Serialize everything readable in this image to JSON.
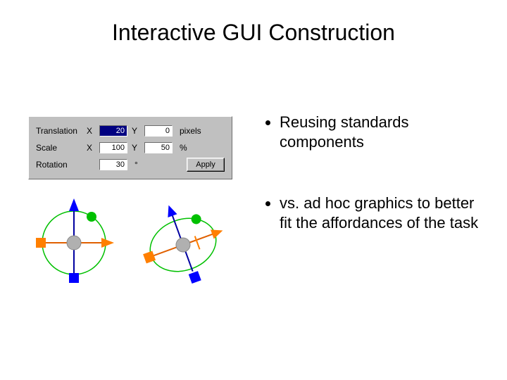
{
  "title": "Interactive GUI Construction",
  "panel": {
    "translation": {
      "label": "Translation",
      "xLabel": "X",
      "x": "20",
      "yLabel": "Y",
      "y": "0",
      "unit": "pixels"
    },
    "scale": {
      "label": "Scale",
      "xLabel": "X",
      "x": "100",
      "yLabel": "Y",
      "y": "50",
      "unit": "%"
    },
    "rotation": {
      "label": "Rotation",
      "value": "30",
      "unit": "°"
    },
    "apply": "Apply"
  },
  "bullets": {
    "item1": "Reusing standards components",
    "item2": "vs. ad hoc graphics to better fit the affordances of the task"
  }
}
